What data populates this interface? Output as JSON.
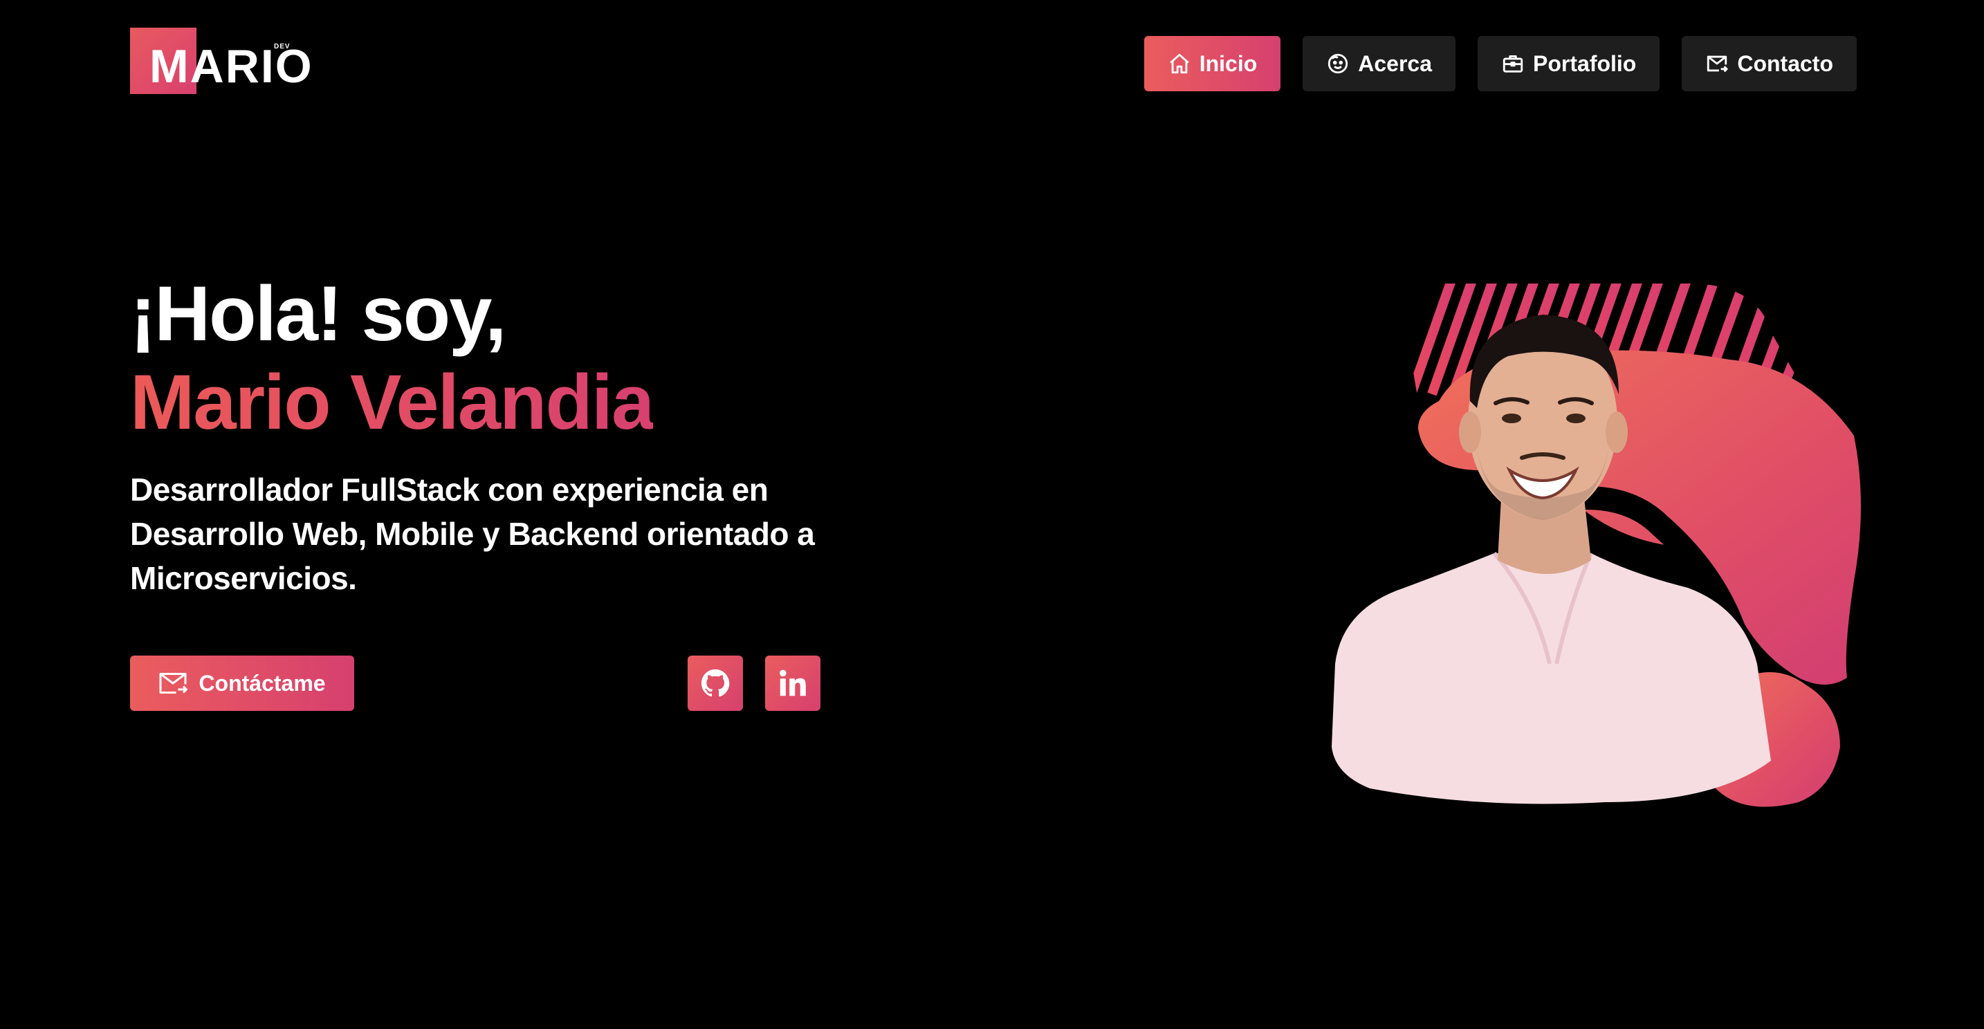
{
  "logo": {
    "text": "MARIO",
    "sub": "DEV"
  },
  "nav": {
    "items": [
      {
        "label": "Inicio",
        "icon": "home-icon",
        "active": true
      },
      {
        "label": "Acerca",
        "icon": "smile-icon",
        "active": false
      },
      {
        "label": "Portafolio",
        "icon": "briefcase-icon",
        "active": false
      },
      {
        "label": "Contacto",
        "icon": "mail-icon",
        "active": false
      }
    ]
  },
  "hero": {
    "greeting": "¡Hola! soy,",
    "name": "Mario Velandia",
    "description": "Desarrollador FullStack con experiencia en Desarrollo Web, Mobile y Backend orientado a Microservicios.",
    "cta_label": "Contáctame",
    "cta_icon": "mail-icon",
    "socials": [
      {
        "name": "GitHub",
        "icon": "github-icon"
      },
      {
        "name": "LinkedIn",
        "icon": "linkedin-icon"
      }
    ],
    "portrait": "profile-photo"
  },
  "colors": {
    "background": "#000000",
    "accent_start": "#ea5d5d",
    "accent_end": "#d6406f",
    "nav_button": "#1e1e1e",
    "text": "#ffffff"
  }
}
